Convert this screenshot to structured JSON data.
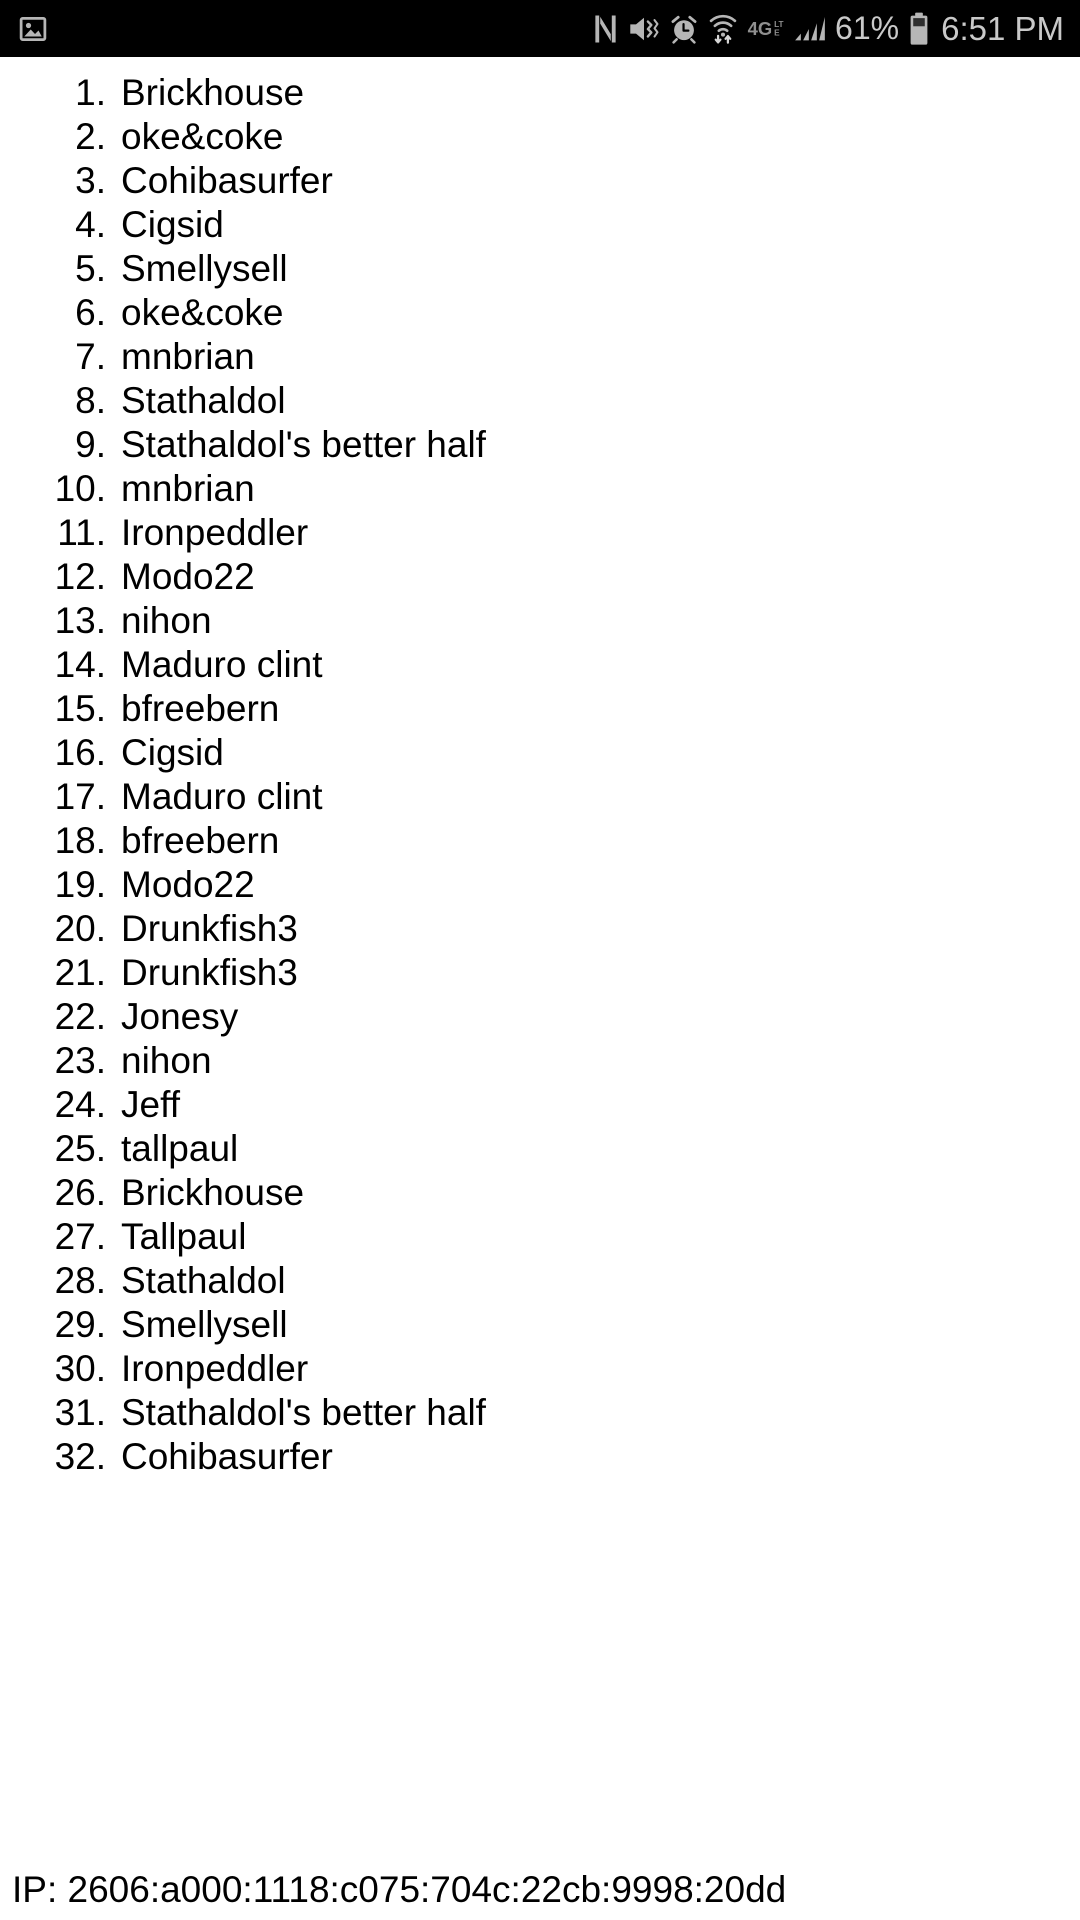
{
  "status_bar": {
    "notification_icon": "image-icon",
    "icons": [
      {
        "name": "nfc-icon",
        "label": "NFC"
      },
      {
        "name": "mute-vibrate-icon",
        "label": "Sound off / vibrate"
      },
      {
        "name": "alarm-clock-icon",
        "label": "Alarm set"
      },
      {
        "name": "wifi-data-transfer-icon",
        "label": "Wi-Fi with data transfer"
      },
      {
        "name": "network-type-4g-lte-icon",
        "label": "4G LTE"
      },
      {
        "name": "cellular-signal-icon",
        "label": "Cellular signal"
      }
    ],
    "network_label": "4G",
    "network_sublabel": "LTE",
    "battery_percent": "61%",
    "clock": "6:51 PM",
    "background_color": "#000000",
    "foreground_color": "#c9c9c9"
  },
  "list": {
    "items": [
      {
        "number": "1.",
        "name": "Brickhouse"
      },
      {
        "number": "2.",
        "name": "oke&coke"
      },
      {
        "number": "3.",
        "name": "Cohibasurfer"
      },
      {
        "number": "4.",
        "name": "Cigsid"
      },
      {
        "number": "5.",
        "name": "Smellysell"
      },
      {
        "number": "6.",
        "name": "oke&coke"
      },
      {
        "number": "7.",
        "name": "mnbrian"
      },
      {
        "number": "8.",
        "name": "Stathaldol"
      },
      {
        "number": "9.",
        "name": "Stathaldol's better half"
      },
      {
        "number": "10.",
        "name": "mnbrian"
      },
      {
        "number": "11.",
        "name": "Ironpeddler"
      },
      {
        "number": "12.",
        "name": "Modo22"
      },
      {
        "number": "13.",
        "name": "nihon"
      },
      {
        "number": "14.",
        "name": "Maduro clint"
      },
      {
        "number": "15.",
        "name": "bfreebern"
      },
      {
        "number": "16.",
        "name": "Cigsid"
      },
      {
        "number": "17.",
        "name": "Maduro clint"
      },
      {
        "number": "18.",
        "name": "bfreebern"
      },
      {
        "number": "19.",
        "name": "Modo22"
      },
      {
        "number": "20.",
        "name": "Drunkfish3"
      },
      {
        "number": "21.",
        "name": "Drunkfish3"
      },
      {
        "number": "22.",
        "name": "Jonesy"
      },
      {
        "number": "23.",
        "name": "nihon"
      },
      {
        "number": "24.",
        "name": "Jeff"
      },
      {
        "number": "25.",
        "name": "tallpaul"
      },
      {
        "number": "26.",
        "name": "Brickhouse"
      },
      {
        "number": "27.",
        "name": "Tallpaul"
      },
      {
        "number": "28.",
        "name": "Stathaldol"
      },
      {
        "number": "29.",
        "name": "Smellysell"
      },
      {
        "number": "30.",
        "name": "Ironpeddler"
      },
      {
        "number": "31.",
        "name": "Stathaldol's better half"
      },
      {
        "number": "32.",
        "name": "Cohibasurfer"
      }
    ]
  },
  "footer": {
    "ip_text": "IP: 2606:a000:1118:c075:704c:22cb:9998:20dd"
  }
}
